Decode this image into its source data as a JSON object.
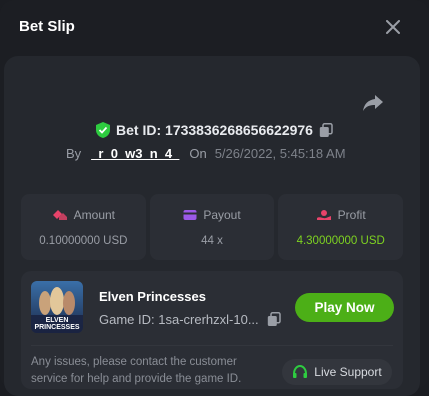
{
  "header": {
    "title": "Bet Slip"
  },
  "bet": {
    "id_text": "Bet ID: 1733836268656622976",
    "by_label": "By",
    "user": "_r_0_w3_n_4_",
    "on_label": "On",
    "date": "5/26/2022, 5:45:18 AM"
  },
  "stats": {
    "amount": {
      "label": "Amount",
      "value": "0.10000000 USD"
    },
    "payout": {
      "label": "Payout",
      "value": "44 x"
    },
    "profit": {
      "label": "Profit",
      "value": "4.30000000 USD"
    }
  },
  "game": {
    "name": "Elven Princesses",
    "id_text": "Game ID: 1sa-crerhzxl-10...",
    "thumb_text": "ELVEN PRINCESSES",
    "play_label": "Play Now",
    "notice": "Any issues, please contact the customer service for help and provide the game ID.",
    "support_label": "Live Support"
  },
  "colors": {
    "accent_green": "#4caf17",
    "profit_green": "#7ed321",
    "shield_green": "#2ecc40",
    "icon_pink": "#e8436a"
  }
}
